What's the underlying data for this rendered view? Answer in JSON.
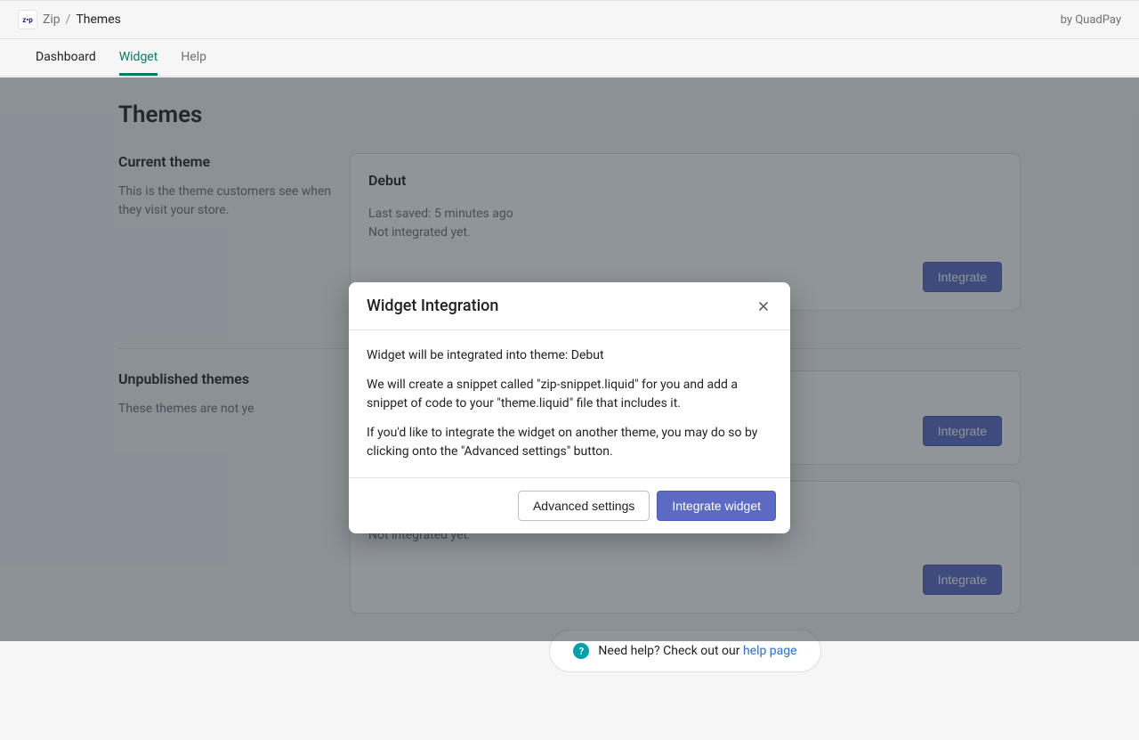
{
  "header": {
    "app_name": "Zip",
    "sep": "/",
    "current": "Themes",
    "attribution": "by QuadPay"
  },
  "tabs": {
    "dashboard": "Dashboard",
    "widget": "Widget",
    "help": "Help"
  },
  "page": {
    "title": "Themes"
  },
  "current": {
    "heading": "Current theme",
    "desc": "This is the theme customers see when they visit your store.",
    "theme": {
      "name": "Debut",
      "saved": "Last saved: 5 minutes ago",
      "status": "Not integrated yet.",
      "cta": "Integrate"
    }
  },
  "unpublished": {
    "heading": "Unpublished themes",
    "desc": "These themes are not ye",
    "themes": [
      {
        "cta": "Integrate"
      },
      {
        "status": "Not integrated yet.",
        "cta": "Integrate"
      }
    ]
  },
  "help": {
    "text_prefix": "Need help? Check out our ",
    "link": "help page"
  },
  "modal": {
    "title": "Widget Integration",
    "p1": "Widget will be integrated into theme: Debut",
    "p2": "We will create a snippet called \"zip-snippet.liquid\" for you and add a snippet of code to your \"theme.liquid\" file that includes it.",
    "p3": "If you'd like to integrate the widget on another theme, you may do so by clicking onto the \"Advanced settings\" button.",
    "advanced": "Advanced settings",
    "cta": "Integrate widget"
  }
}
